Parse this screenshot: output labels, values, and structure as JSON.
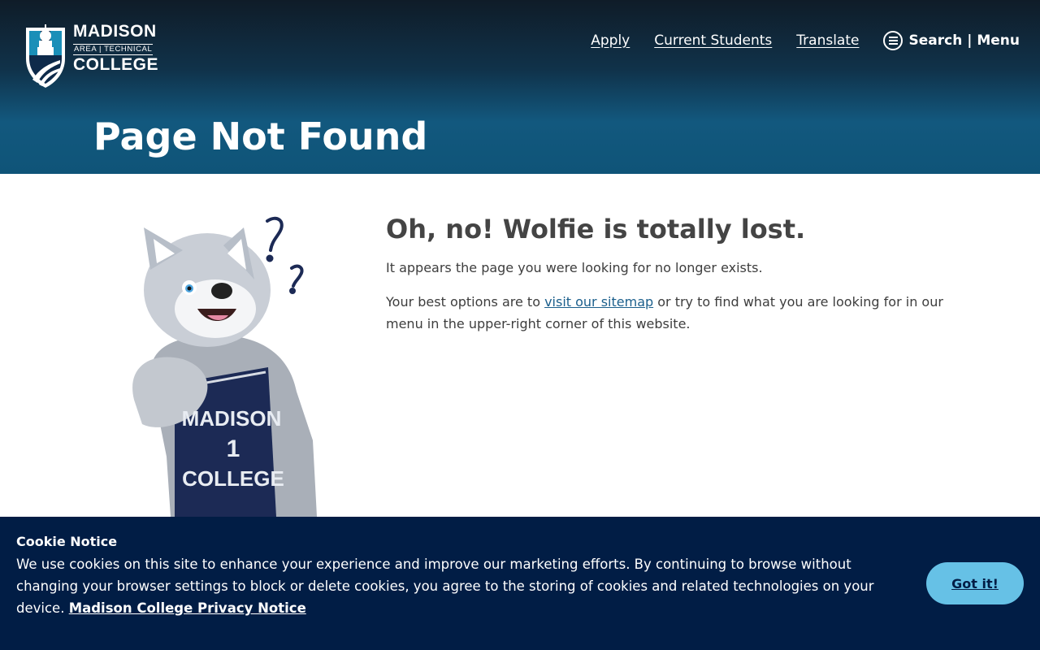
{
  "brand": {
    "logo_line1": "MADISON",
    "logo_line2": "AREA | TECHNICAL",
    "logo_line3": "COLLEGE"
  },
  "nav": {
    "apply": "Apply",
    "current_students": "Current Students",
    "translate": "Translate",
    "search_menu": "Search | Menu"
  },
  "page": {
    "title": "Page Not Found"
  },
  "main": {
    "heading": "Oh, no! Wolfie is totally lost.",
    "para1": "It appears the page you were looking for no longer exists.",
    "para2_before": "Your best options are to ",
    "sitemap_link": "visit our sitemap",
    "para2_after": " or try to find what you are looking for in our menu in the upper-right corner of this website."
  },
  "mascot_jersey": {
    "line1": "MADISON",
    "number": "1",
    "line2": "COLLEGE"
  },
  "cookie": {
    "title": "Cookie Notice",
    "text": "We use cookies on this site to enhance your experience and improve our marketing efforts. By continuing to browse without changing your browser settings to block or delete cookies, you agree to the storing of cookies and related technologies on your device. ",
    "privacy_link": "Madison College Privacy Notice",
    "button": "Got it!"
  },
  "colors": {
    "header_dark": "#0f1c28",
    "header_blue": "#12587e",
    "cookie_bg": "#011d45",
    "button_bg": "#66c1e6",
    "link": "#1b5f8c"
  },
  "icons": [
    "shield-logo-icon",
    "menu-icon",
    "question-mark-icon"
  ]
}
